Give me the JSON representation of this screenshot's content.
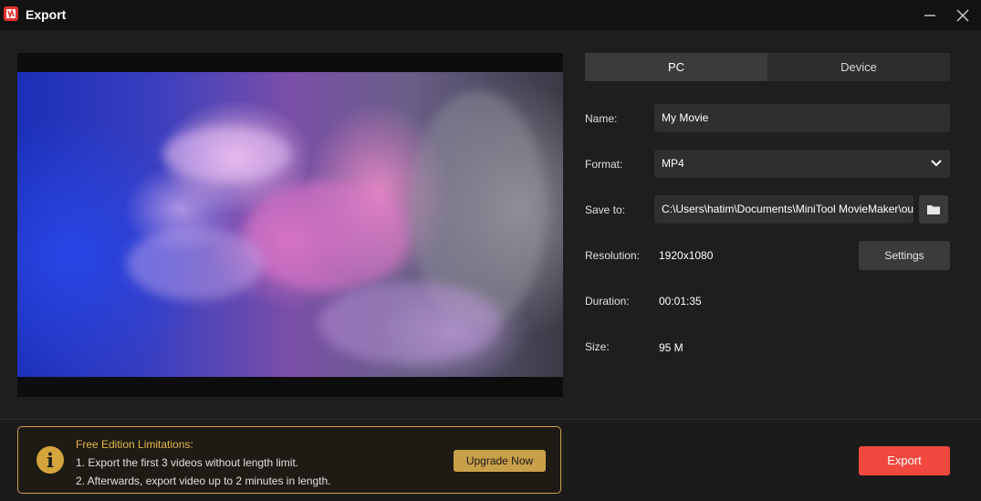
{
  "window": {
    "title": "Export",
    "minimize_icon": "minimize-icon",
    "close_icon": "close-icon"
  },
  "tabs": [
    {
      "label": "PC",
      "active": true
    },
    {
      "label": "Device",
      "active": false
    }
  ],
  "form": {
    "name_label": "Name:",
    "name_value": "My Movie",
    "format_label": "Format:",
    "format_value": "MP4",
    "save_label": "Save to:",
    "save_value": "C:\\Users\\hatim\\Documents\\MiniTool MovieMaker\\output",
    "resolution_label": "Resolution:",
    "resolution_value": "1920x1080",
    "settings_label": "Settings",
    "duration_label": "Duration:",
    "duration_value": "00:01:35",
    "size_label": "Size:",
    "size_value": "95 M"
  },
  "notice": {
    "title": "Free Edition Limitations:",
    "line1": "1. Export the first 3 videos without length limit.",
    "line2": "2. Afterwards, export video up to 2 minutes in length.",
    "upgrade_label": "Upgrade Now"
  },
  "export_label": "Export",
  "colors": {
    "accent_export": "#f0483e",
    "notice_gold": "#c9a54a",
    "background": "#1e1e1e"
  }
}
